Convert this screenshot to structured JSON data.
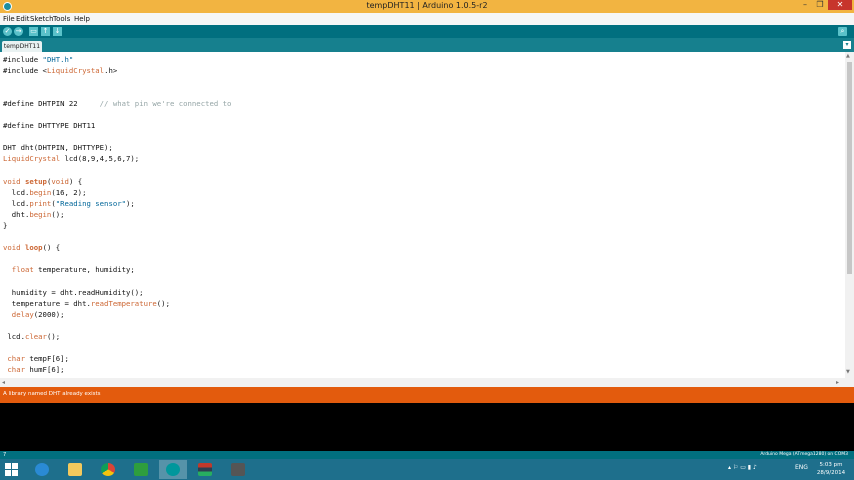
{
  "window": {
    "title": "tempDHT11 | Arduino 1.0.5-r2",
    "minimize_glyph": "–",
    "maximize_glyph": "❐",
    "close_glyph": "✕"
  },
  "menu": [
    "File",
    "Edit",
    "Sketch",
    "Tools",
    "Help"
  ],
  "toolbar": {
    "verify_icon": "✓",
    "upload_icon": "→",
    "new_icon": "▭",
    "open_icon": "↑",
    "save_icon": "↓",
    "serial_monitor_icon": "⌕"
  },
  "tabs": [
    {
      "label": "tempDHT11"
    }
  ],
  "tab_menu_icon": "▾",
  "code": {
    "l1a": "#include ",
    "l1b": "\"DHT.h\"",
    "l2a": "#include <",
    "l2b": "LiquidCrystal",
    "l2c": ".h>",
    "l3a": "#define DHTPIN 22     ",
    "l3b": "// what pin we're connected to",
    "l4": "#define DHTTYPE DHT11",
    "l5": "DHT dht(DHTPIN, DHTTYPE);",
    "l6a": "LiquidCrystal",
    "l6b": " lcd(8,9,4,5,6,7);",
    "l7a": "void",
    "l7b": " ",
    "l7c": "setup",
    "l7d": "(",
    "l7e": "void",
    "l7f": ") {",
    "l8a": "  lcd.",
    "l8b": "begin",
    "l8c": "(16, 2);",
    "l9a": "  lcd.",
    "l9b": "print",
    "l9c": "(",
    "l9d": "\"Reading sensor\"",
    "l9e": ");",
    "l10a": "  dht.",
    "l10b": "begin",
    "l10c": "();",
    "l11": "}",
    "l12a": "void",
    "l12b": " ",
    "l12c": "loop",
    "l12d": "() {",
    "l13a": "  ",
    "l13b": "float",
    "l13c": " temperature, humidity;",
    "l14": "  humidity = dht.readHumidity();",
    "l15a": "  temperature = dht.",
    "l15b": "readTemperature",
    "l15c": "();",
    "l16a": "  ",
    "l16b": "delay",
    "l16c": "(2000);",
    "l17a": " lcd.",
    "l17b": "clear",
    "l17c": "();",
    "l18a": " ",
    "l18b": "char",
    "l18c": " tempF[6];",
    "l19a": " ",
    "l19b": "char",
    "l19c": " humF[6];"
  },
  "scroll": {
    "up": "▲",
    "down": "▼",
    "left": "◂",
    "right": "▸"
  },
  "status": {
    "message": "A library named DHT already exists"
  },
  "footer": {
    "line_number": "7",
    "board": "Arduino Mega (ATmega1280) on COM3"
  },
  "taskbar": {
    "language": "ENG",
    "time": "5:03 pm",
    "date": "28/9/2014",
    "tray_icons": "▴ ⚐ ▭ ▮ ♪"
  }
}
